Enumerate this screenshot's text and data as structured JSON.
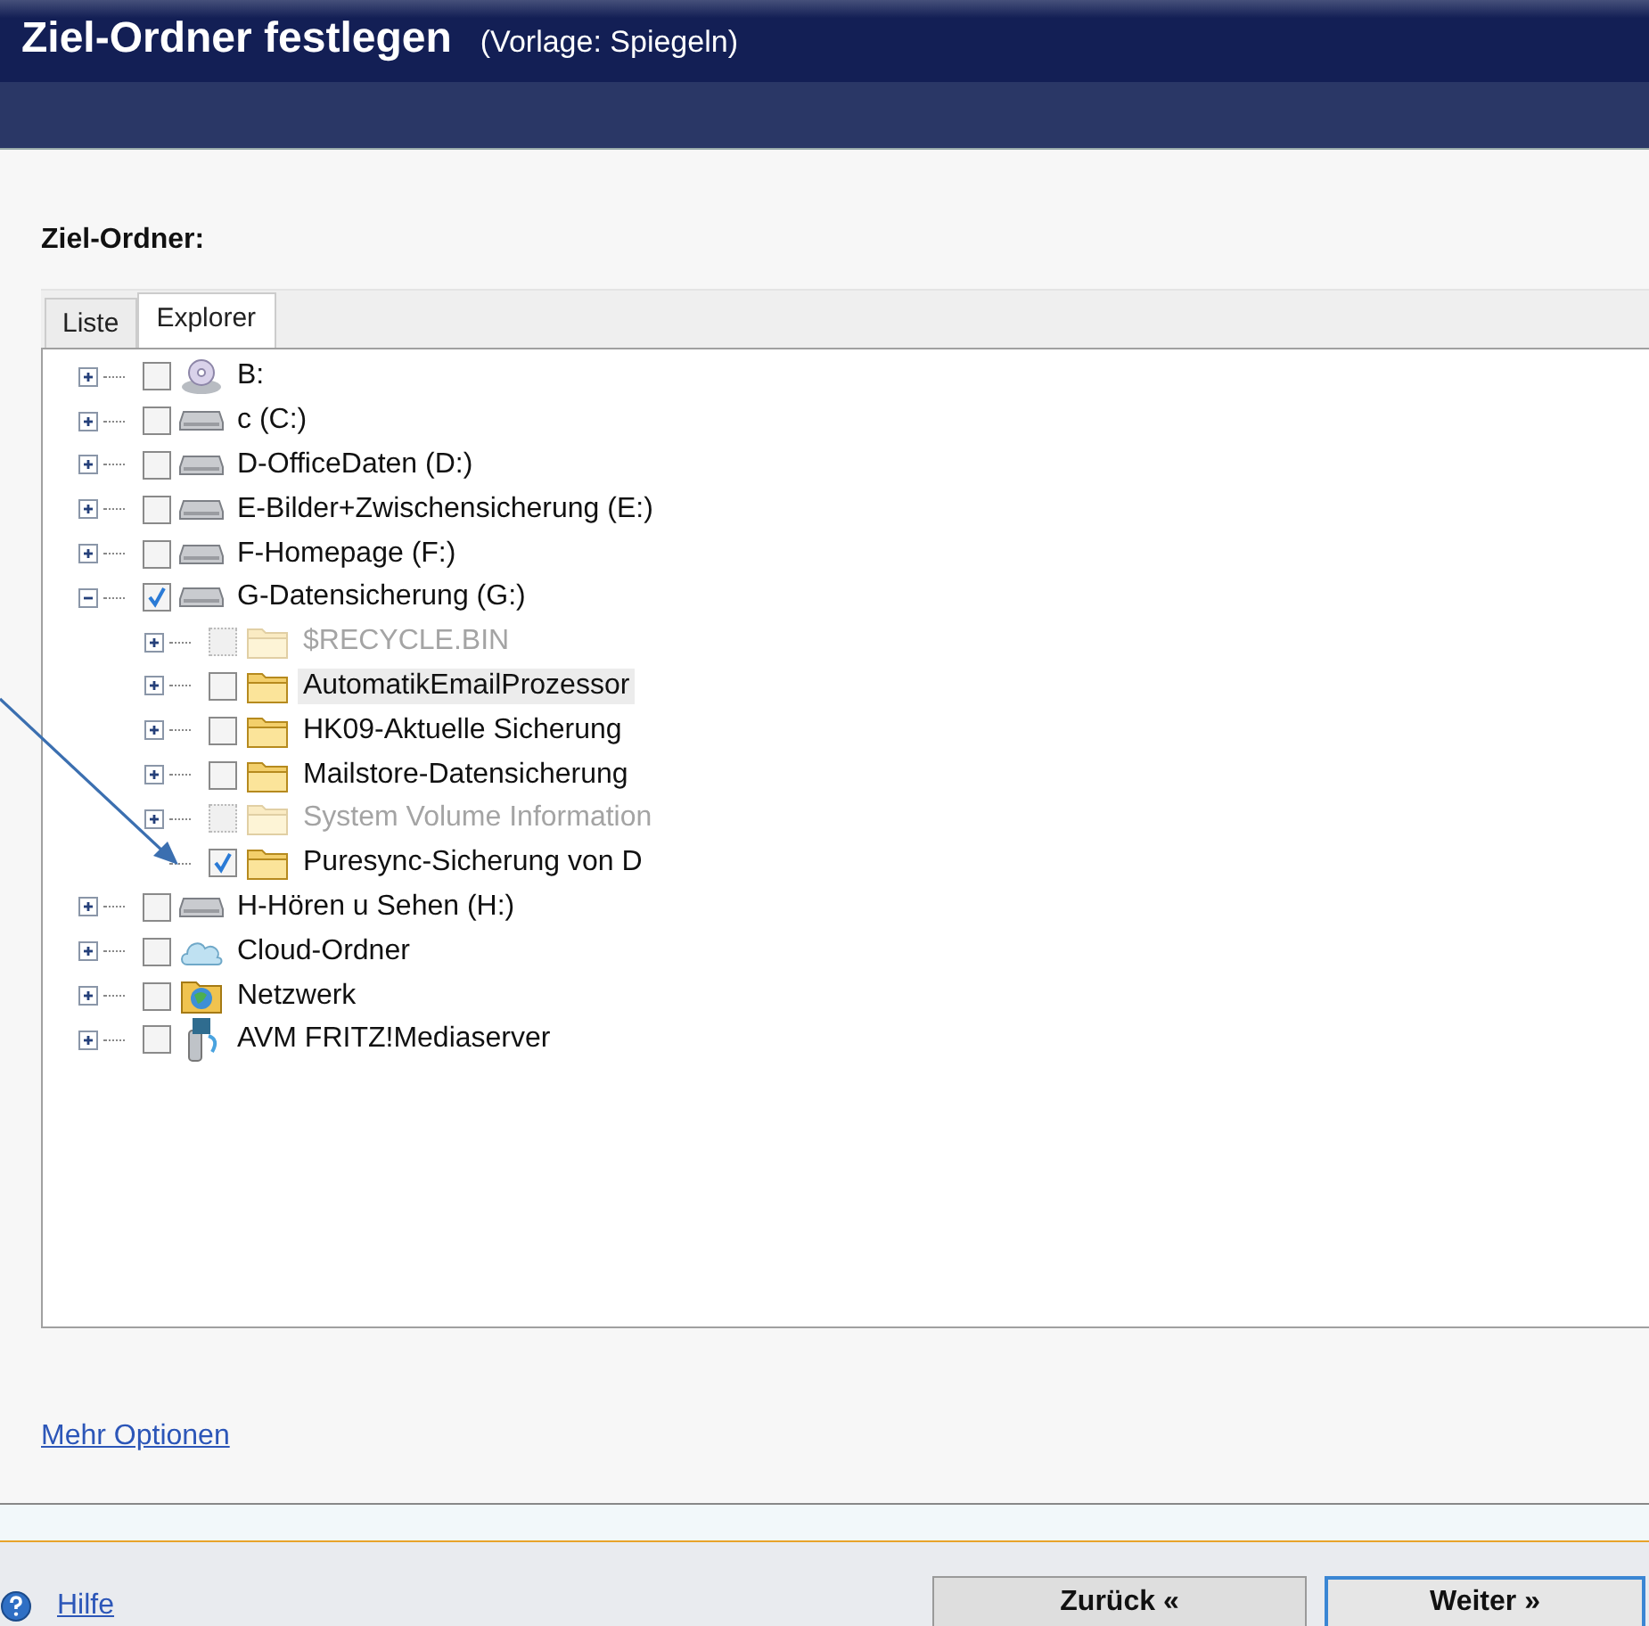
{
  "header": {
    "title": "Ziel-Ordner festlegen",
    "subtitle": "(Vorlage: Spiegeln)"
  },
  "section_label": "Ziel-Ordner:",
  "tabs": [
    {
      "label": "Liste",
      "selected": false
    },
    {
      "label": "Explorer",
      "selected": true
    }
  ],
  "tree": [
    {
      "label": "B:",
      "kind": "cd",
      "checked": false,
      "disabled": false,
      "selected": false,
      "expandable": true,
      "expanded": false
    },
    {
      "label": "c (C:)",
      "kind": "drive",
      "checked": false,
      "disabled": false,
      "selected": false,
      "expandable": true,
      "expanded": false
    },
    {
      "label": "D-OfficeDaten (D:)",
      "kind": "drive",
      "checked": false,
      "disabled": false,
      "selected": false,
      "expandable": true,
      "expanded": false
    },
    {
      "label": "E-Bilder+Zwischensicherung (E:)",
      "kind": "drive",
      "checked": false,
      "disabled": false,
      "selected": false,
      "expandable": true,
      "expanded": false
    },
    {
      "label": "F-Homepage (F:)",
      "kind": "drive",
      "checked": false,
      "disabled": false,
      "selected": false,
      "expandable": true,
      "expanded": false
    },
    {
      "label": "G-Datensicherung (G:)",
      "kind": "drive",
      "checked": true,
      "disabled": false,
      "selected": false,
      "expandable": true,
      "expanded": true,
      "children": [
        {
          "label": "$RECYCLE.BIN",
          "kind": "folder",
          "checked": false,
          "disabled": true,
          "selected": false,
          "expandable": true,
          "expanded": false
        },
        {
          "label": "AutomatikEmailProzessor",
          "kind": "folder",
          "checked": false,
          "disabled": false,
          "selected": true,
          "expandable": true,
          "expanded": false
        },
        {
          "label": "HK09-Aktuelle Sicherung",
          "kind": "folder",
          "checked": false,
          "disabled": false,
          "selected": false,
          "expandable": true,
          "expanded": false
        },
        {
          "label": "Mailstore-Datensicherung",
          "kind": "folder",
          "checked": false,
          "disabled": false,
          "selected": false,
          "expandable": true,
          "expanded": false
        },
        {
          "label": "System Volume Information",
          "kind": "folder",
          "checked": false,
          "disabled": true,
          "selected": false,
          "expandable": true,
          "expanded": false
        },
        {
          "label": "Puresync-Sicherung von D",
          "kind": "folder",
          "checked": true,
          "disabled": false,
          "selected": false,
          "expandable": false
        }
      ]
    },
    {
      "label": "H-Hören u Sehen (H:)",
      "kind": "drive",
      "checked": false,
      "disabled": false,
      "selected": false,
      "expandable": true,
      "expanded": false
    },
    {
      "label": "Cloud-Ordner",
      "kind": "cloud",
      "checked": false,
      "disabled": false,
      "selected": false,
      "expandable": true,
      "expanded": false
    },
    {
      "label": "Netzwerk",
      "kind": "network",
      "checked": false,
      "disabled": false,
      "selected": false,
      "expandable": true,
      "expanded": false
    },
    {
      "label": "AVM FRITZ!Mediaserver",
      "kind": "media",
      "checked": false,
      "disabled": false,
      "selected": false,
      "expandable": true,
      "expanded": false
    }
  ],
  "more_options_link": "Mehr Optionen",
  "footer": {
    "help_link": "Hilfe",
    "buttons": [
      {
        "label": "Zurück «",
        "kind": "secondary"
      },
      {
        "label": "Weiter »",
        "kind": "primary"
      }
    ]
  }
}
